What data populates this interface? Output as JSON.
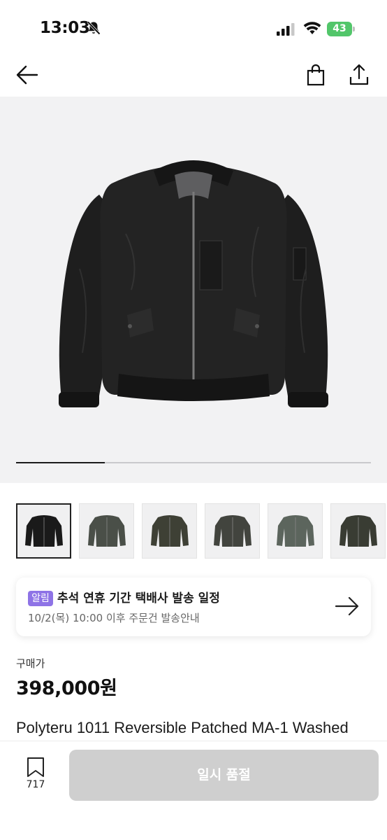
{
  "status_bar": {
    "time": "13:03",
    "battery": "43"
  },
  "nav": {
    "back_icon": "arrow-left-icon",
    "bag_icon": "shopping-bag-icon",
    "share_icon": "share-icon"
  },
  "gallery": {
    "image_count": 6,
    "selected_index": 0,
    "progress_fraction": 0.25,
    "thumbnails": [
      {
        "color": "#1a1a1a"
      },
      {
        "color": "#4a4f48"
      },
      {
        "color": "#3e4035"
      },
      {
        "color": "#42443e"
      },
      {
        "color": "#5c655d"
      },
      {
        "color": "#393c33"
      }
    ]
  },
  "notice": {
    "badge": "알림",
    "title": "추석 연휴 기간 택배사 발송 일정",
    "subtitle": "10/2(목) 10:00 이후 주문건 발송안내"
  },
  "price": {
    "label": "구매가",
    "value": "398,000원"
  },
  "product": {
    "title": "Polyteru 1011 Reversible Patched MA-1 Washed"
  },
  "bottom_bar": {
    "bookmark_count": "717",
    "action_label": "일시 품절"
  },
  "colors": {
    "accent_badge": "#8e73e6",
    "battery_green": "#52c66a",
    "disabled_button": "#cfcfcf"
  }
}
